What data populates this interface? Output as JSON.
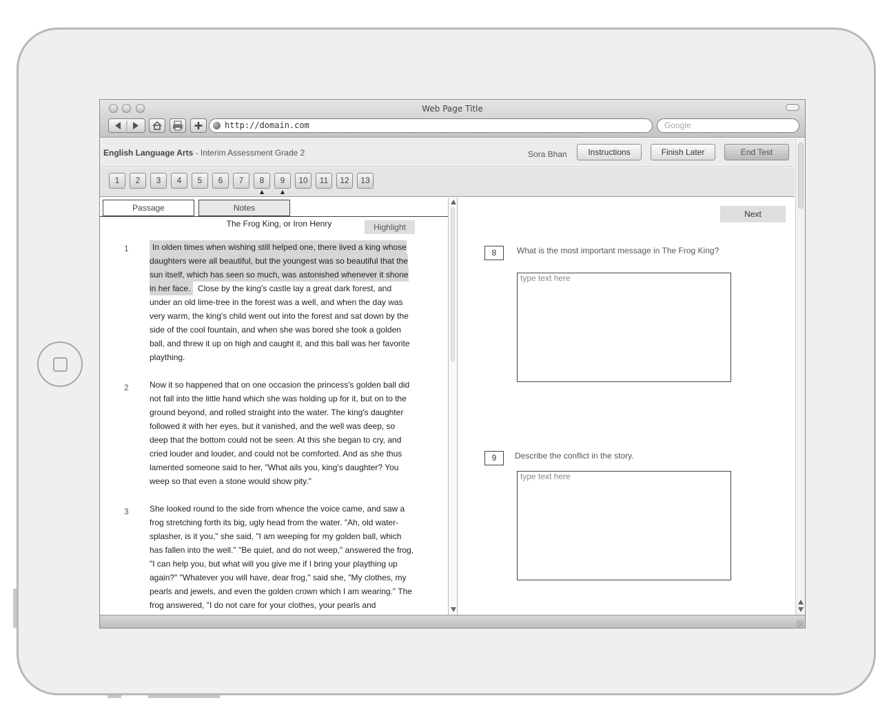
{
  "window": {
    "title": "Web Page Title",
    "url": "http://domain.com",
    "search_placeholder": "Google",
    "nav_icons": [
      "back-arrow-icon",
      "forward-arrow-icon",
      "home-icon",
      "print-icon",
      "add-bookmark-icon"
    ]
  },
  "header": {
    "subject": "English Language Arts",
    "assessment": " - Interim Assessment Grade 2",
    "user": "Sora Bhan",
    "instructions_label": "Instructions",
    "finish_later_label": "Finish Later",
    "end_test_label": "End Test"
  },
  "question_nav": {
    "numbers": [
      "1",
      "2",
      "3",
      "4",
      "5",
      "6",
      "7",
      "8",
      "9",
      "10",
      "11",
      "12",
      "13"
    ],
    "current": [
      "8",
      "9"
    ]
  },
  "passage_pane": {
    "tabs": [
      "Passage",
      "Notes"
    ],
    "title": "The Frog King, or Iron Henry",
    "highlight_label": "Highlight",
    "paragraphs": [
      {
        "num": "1",
        "highlighted": "In olden times when wishing still helped one, there lived a king whose daughters were all beautiful, but the youngest was so beautiful that the sun itself, which has seen so much, was astonished whenever it shone in her face.",
        "text": "Close by the king's castle lay a great dark forest, and under an old lime-tree in the forest was a well, and when the day was very warm, the king's child went out into the forest and sat down by the side of the cool fountain, and when she was bored she took a golden ball, and threw it up on high and caught it, and this ball was her favorite plaything."
      },
      {
        "num": "2",
        "text": "Now it so happened that on one occasion the princess's golden ball did not fall into the little hand which she was holding up for it, but on to the ground beyond, and rolled straight into the water. The king's daughter followed it with her eyes, but it vanished, and the well was deep, so deep that the bottom could not be seen. At this she began to cry, and cried louder and louder, and could not be comforted. And as she thus lamented someone said to her, \"What ails you, king's daughter? You weep so that even a stone would show pity.\""
      },
      {
        "num": "3",
        "text": "She looked round to the side from whence the voice came, and saw a frog stretching forth its big, ugly head from the water. \"Ah, old water-splasher, is it you,\" she said, \"I am weeping for my golden ball, which has fallen into the well.\" \"Be quiet, and do not weep,\" answered the frog, \"I can help you, but what will you give me if I bring your plaything up again?\" \"Whatever you will have, dear frog,\" said she, \"My clothes, my pearls and jewels, and even the golden crown which I am wearing.\" The frog answered, \"I do not care for your clothes, your pearls and"
      }
    ]
  },
  "question_pane": {
    "next_label": "Next",
    "questions": [
      {
        "num": "8",
        "prompt": "What is the most important message in The Frog King?",
        "placeholder": "type text here"
      },
      {
        "num": "9",
        "prompt": "Describe the conflict in the story.",
        "placeholder": "type text here"
      }
    ]
  }
}
